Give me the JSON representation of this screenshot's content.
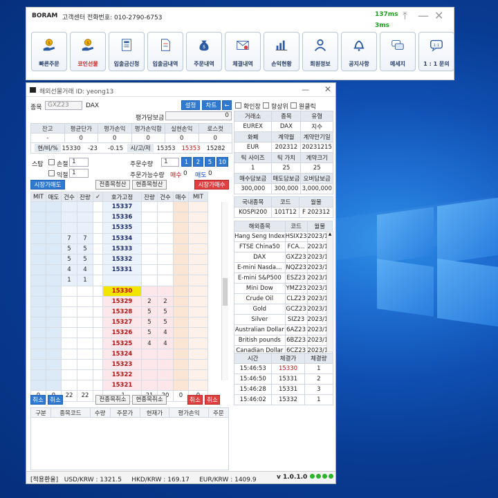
{
  "launcher": {
    "brand": "BORAM",
    "customer_service": "고객센터 전화번호: 010-2790-6753",
    "ping_top": "137ms",
    "ping_bottom": "3ms",
    "menu": [
      {
        "label": "빠른주문",
        "icon": "coin-hand-icon"
      },
      {
        "label": "코인선물",
        "icon": "coin-hand-icon"
      },
      {
        "label": "입출금신청",
        "icon": "form-icon"
      },
      {
        "label": "입출금내역",
        "icon": "document-icon"
      },
      {
        "label": "주문내역",
        "icon": "money-bag-icon"
      },
      {
        "label": "체결내역",
        "icon": "envelope-icon"
      },
      {
        "label": "손익현황",
        "icon": "bar-chart-icon"
      },
      {
        "label": "회원정보",
        "icon": "user-icon"
      },
      {
        "label": "공지사항",
        "icon": "bell-icon"
      },
      {
        "label": "메세지",
        "icon": "chat-icon"
      },
      {
        "label": "1 : 1 문의",
        "icon": "message-icon"
      }
    ]
  },
  "window": {
    "title": "해외선물거래",
    "user_id": "ID: yeong13"
  },
  "form": {
    "symbol_label": "종목",
    "symbol_code": "GXZ23",
    "symbol_name": "DAX",
    "settings_btn": "설정",
    "chart_btn": "차트",
    "arrow_btn": "←",
    "margin_label": "평가담보금",
    "margin_value": "0",
    "stats_headers": [
      "잔고",
      "평균단가",
      "평가손익",
      "평가손익합",
      "실현손익",
      "로스컷"
    ],
    "stats_values": [
      "-",
      "0",
      "0",
      "0",
      "0",
      "0"
    ],
    "row3": [
      "현/비/%",
      "15330",
      "-23",
      "-0.15",
      "시/고/저",
      "15353",
      "15353",
      "15282"
    ],
    "stop_label": "스탑",
    "loss_label": "손절",
    "profit_label": "익절",
    "loss_value": "1",
    "profit_value": "1",
    "qty_label": "주문수량",
    "qty_value": "1",
    "qty_presets": [
      "1",
      "2",
      "5",
      "10"
    ],
    "avail_label": "주문가능수량",
    "avail_buy_label": "매수",
    "avail_buy": "0",
    "avail_sell_label": "매도",
    "avail_sell": "0",
    "market_sell": "시장가매도",
    "market_buy": "시장가매수",
    "close_all": "전종목청산",
    "close_cur": "현종목청산",
    "cancel_all": "전종목취소",
    "cancel_cur": "현종목취소",
    "cancel": "취소"
  },
  "book": {
    "headers": [
      "MIT",
      "매도",
      "건수",
      "잔량",
      "✓",
      "호가고정",
      "잔량",
      "건수",
      "매수",
      "MIT"
    ],
    "rows": [
      {
        "price": "15337",
        "ask_cnt": "",
        "ask_qty": "",
        "bid_qty": "",
        "bid_cnt": ""
      },
      {
        "price": "15336",
        "ask_cnt": "",
        "ask_qty": "",
        "bid_qty": "",
        "bid_cnt": ""
      },
      {
        "price": "15335",
        "ask_cnt": "",
        "ask_qty": "",
        "bid_qty": "",
        "bid_cnt": ""
      },
      {
        "price": "15334",
        "ask_cnt": "7",
        "ask_qty": "7",
        "bid_qty": "",
        "bid_cnt": ""
      },
      {
        "price": "15333",
        "ask_cnt": "5",
        "ask_qty": "5",
        "bid_qty": "",
        "bid_cnt": ""
      },
      {
        "price": "15332",
        "ask_cnt": "5",
        "ask_qty": "5",
        "bid_qty": "",
        "bid_cnt": ""
      },
      {
        "price": "15331",
        "ask_cnt": "4",
        "ask_qty": "4",
        "bid_qty": "",
        "bid_cnt": ""
      },
      {
        "price": "",
        "ask_cnt": "1",
        "ask_qty": "1",
        "bid_qty": "",
        "bid_cnt": ""
      },
      {
        "price": "15330",
        "ask_cnt": "",
        "ask_qty": "",
        "bid_qty": "",
        "bid_cnt": "",
        "selected": true
      },
      {
        "price": "15329",
        "ask_cnt": "",
        "ask_qty": "",
        "bid_qty": "2",
        "bid_cnt": "2"
      },
      {
        "price": "15328",
        "ask_cnt": "",
        "ask_qty": "",
        "bid_qty": "5",
        "bid_cnt": "5"
      },
      {
        "price": "15327",
        "ask_cnt": "",
        "ask_qty": "",
        "bid_qty": "5",
        "bid_cnt": "5"
      },
      {
        "price": "15326",
        "ask_cnt": "",
        "ask_qty": "",
        "bid_qty": "5",
        "bid_cnt": "4"
      },
      {
        "price": "15325",
        "ask_cnt": "",
        "ask_qty": "",
        "bid_qty": "4",
        "bid_cnt": "4"
      },
      {
        "price": "15324",
        "ask_cnt": "",
        "ask_qty": "",
        "bid_qty": "",
        "bid_cnt": ""
      },
      {
        "price": "15323",
        "ask_cnt": "",
        "ask_qty": "",
        "bid_qty": "",
        "bid_cnt": ""
      },
      {
        "price": "15322",
        "ask_cnt": "",
        "ask_qty": "",
        "bid_qty": "",
        "bid_cnt": ""
      },
      {
        "price": "15321",
        "ask_cnt": "",
        "ask_qty": "",
        "bid_qty": "",
        "bid_cnt": ""
      }
    ],
    "totals": [
      "0",
      "0",
      "22",
      "22",
      "",
      "-1",
      "21",
      "20",
      "0",
      "0"
    ]
  },
  "positions": {
    "headers": [
      "구분",
      "종목코드",
      "수량",
      "주문가",
      "현재가",
      "평가손익",
      "주문"
    ]
  },
  "right": {
    "chk_confirm": "확인창",
    "chk_top": "항상위",
    "chk_oneclick": "원클릭",
    "info_rows": [
      [
        "거래소",
        "종목",
        "유형"
      ],
      [
        "EUREX",
        "DAX",
        "지수"
      ],
      [
        "화폐",
        "계약월",
        "계약만기일"
      ],
      [
        "EUR",
        "202312",
        "20231215"
      ],
      [
        "틱 사이즈",
        "틱 가치",
        "계약크기"
      ],
      [
        "1",
        "25",
        "25"
      ],
      [
        "매수담보금",
        "매도담보금",
        "오버담보금"
      ],
      [
        "300,000",
        "300,000",
        "3,000,000"
      ]
    ],
    "domestic_headers": [
      "국내종목",
      "코드",
      "월물"
    ],
    "domestic_row": [
      "KOSPI200",
      "101T12",
      "F 202312"
    ],
    "foreign_headers": [
      "해외종목",
      "코드",
      "월물"
    ],
    "foreign": [
      [
        "Hang Seng Index",
        "HSIX23",
        "2023/11"
      ],
      [
        "FTSE China50",
        "FCA…",
        "2023/11"
      ],
      [
        "DAX",
        "GXZ23",
        "2023/12"
      ],
      [
        "E-mini Nasda…",
        "NQZ23",
        "2023/12"
      ],
      [
        "E-mini S&P500",
        "ESZ23",
        "2023/12"
      ],
      [
        "Mini Dow",
        "YMZ23",
        "2023/12"
      ],
      [
        "Crude Oil",
        "CLZ23",
        "2023/12"
      ],
      [
        "Gold",
        "GCZ23",
        "2023/12"
      ],
      [
        "Silver",
        "SIZ23",
        "2023/12"
      ],
      [
        "Australian Dollar",
        "6AZ23",
        "2023/12"
      ],
      [
        "British pounds",
        "6BZ23",
        "2023/12"
      ],
      [
        "Canadian Dollar",
        "6CZ23",
        "2023/12"
      ]
    ],
    "trades_headers": [
      "시간",
      "체결가",
      "체결량"
    ],
    "trades": [
      [
        "15:46:53",
        "15330",
        "1"
      ],
      [
        "15:46:50",
        "15331",
        "2"
      ],
      [
        "15:46:28",
        "15331",
        "3"
      ],
      [
        "15:46:02",
        "15332",
        "1"
      ]
    ]
  },
  "status": {
    "fx": "[적용환율]   USD/KRW : 1321.5     HKD/KRW : 169.17     EUR/KRW : 1409.9",
    "version": "v 1.0.1.0"
  }
}
